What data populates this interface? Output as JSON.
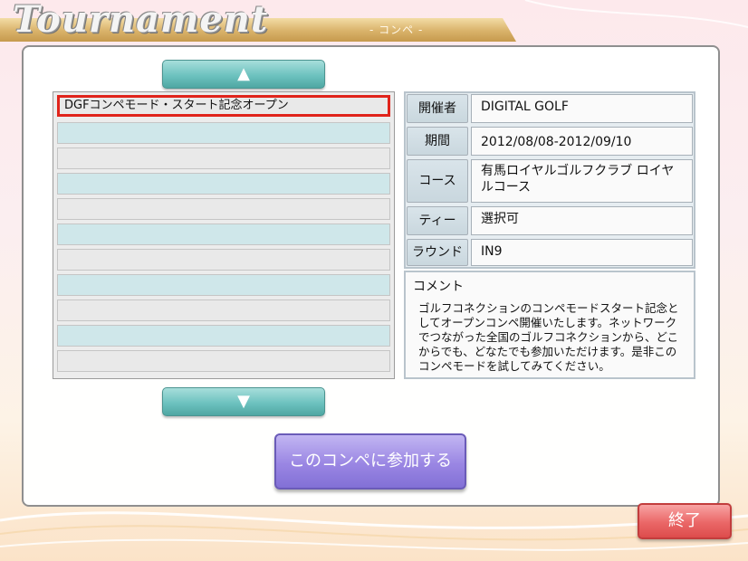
{
  "header": {
    "title": "Tournament",
    "subtitle": "- コンペ -"
  },
  "list": {
    "scroll_up_glyph": "▲",
    "scroll_down_glyph": "▼",
    "items": [
      {
        "label": "DGFコンペモード・スタート記念オープン",
        "selected": true
      },
      {
        "label": ""
      },
      {
        "label": ""
      },
      {
        "label": ""
      },
      {
        "label": ""
      },
      {
        "label": ""
      },
      {
        "label": ""
      },
      {
        "label": ""
      },
      {
        "label": ""
      },
      {
        "label": ""
      },
      {
        "label": ""
      }
    ]
  },
  "details": {
    "organizer_label": "開催者",
    "organizer_value": "DIGITAL GOLF",
    "period_label": "期間",
    "period_value": "2012/08/08-2012/09/10",
    "course_label": "コース",
    "course_value": "有馬ロイヤルゴルフクラブ ロイヤルコース",
    "tee_label": "ティー",
    "tee_value": "選択可",
    "round_label": "ラウンド",
    "round_value": "IN9",
    "comment_label": "コメント",
    "comment_text": "ゴルフコネクションのコンペモードスタート記念としてオープンコンペ開催いたします。ネットワークでつながった全国のゴルフコネクションから、どこからでも、どなたでも参加いただけます。是非このコンペモードを試してみてください。"
  },
  "buttons": {
    "join_label": "このコンペに参加する",
    "exit_label": "終了"
  },
  "colors": {
    "selected_border": "#e0241b",
    "arrow_button": "#6dc2bf",
    "join_button": "#9a86e3",
    "exit_button": "#ea6767"
  }
}
